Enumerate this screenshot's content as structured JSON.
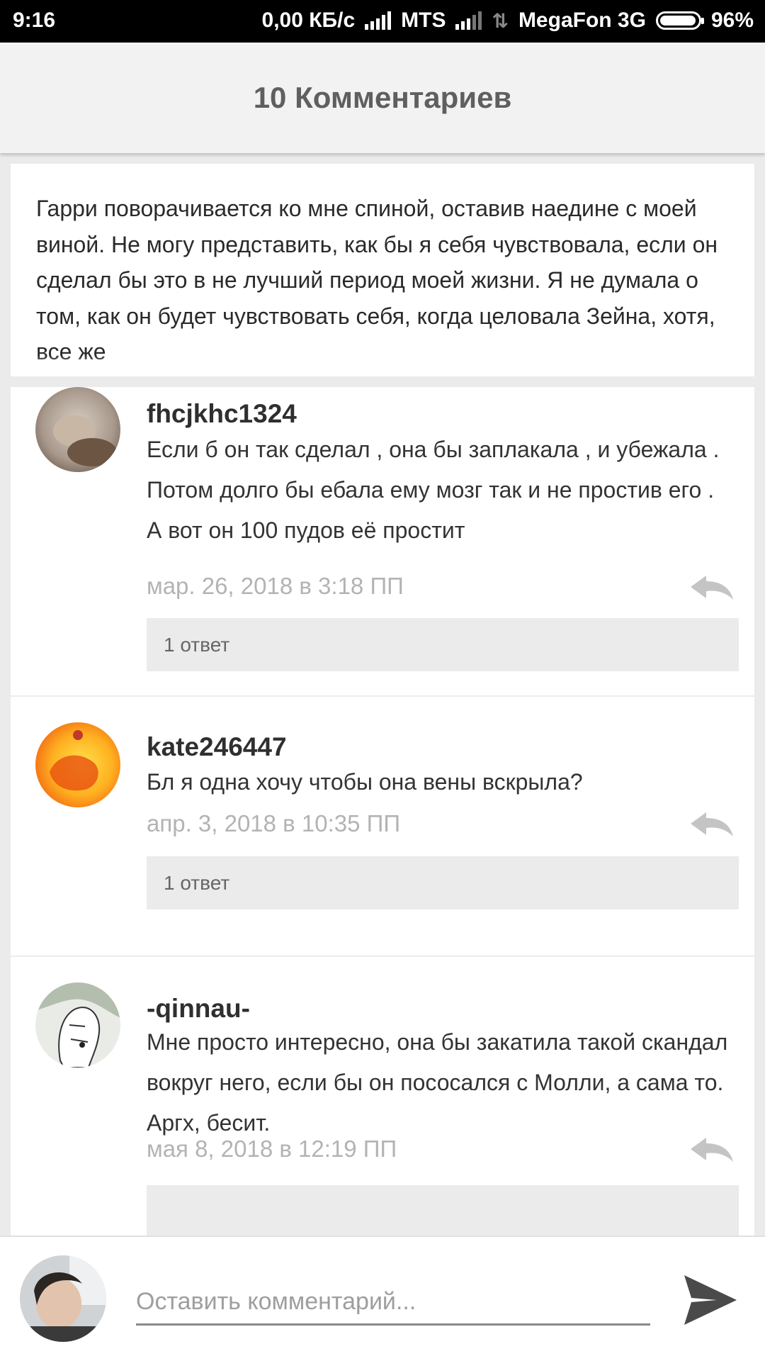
{
  "status_bar": {
    "time": "9:16",
    "speed": "0,00 КБ/с",
    "carrier1": "MTS",
    "carrier2": "MegaFon 3G",
    "battery": "96%"
  },
  "header": {
    "title": "10 Комментариев"
  },
  "excerpt": {
    "text": "Гарри поворачивается ко мне спиной, оставив наедине с моей виной. Не могу представить, как бы я себя чувствовала, если он сделал бы это в не лучший период моей жизни. Я не думала о том, как он будет чувствовать себя, когда целовала Зейна, хотя, все же"
  },
  "comments": [
    {
      "user": "fhcjkhc1324",
      "text": "Если б он так сделал , она бы заплакала , и убежала . Потом долго бы ебала ему мозг так и не простив его . А вот он 100 пудов её простит",
      "date": "мар. 26, 2018 в 3:18 ПП",
      "replies": "1 ответ"
    },
    {
      "user": "kate246447",
      "text": "Бл я одна хочу чтобы она вены вскрыла?",
      "date": "апр. 3, 2018 в 10:35 ПП",
      "replies": "1 ответ"
    },
    {
      "user": "-qinnau-",
      "text": "Мне просто интересно, она бы закатила такой скандал вокруг него, если бы он пососался с Молли, а сама то. Аргх, бесит.",
      "date": "мая 8, 2018 в 12:19 ПП"
    }
  ],
  "compose": {
    "placeholder": "Оставить комментарий..."
  },
  "icons": {
    "reply": "reply-arrow-icon",
    "send": "send-icon"
  },
  "colors": {
    "header_bg": "#f2f2f2",
    "page_bg": "#ebebeb",
    "date_text": "#b3b3b3"
  }
}
